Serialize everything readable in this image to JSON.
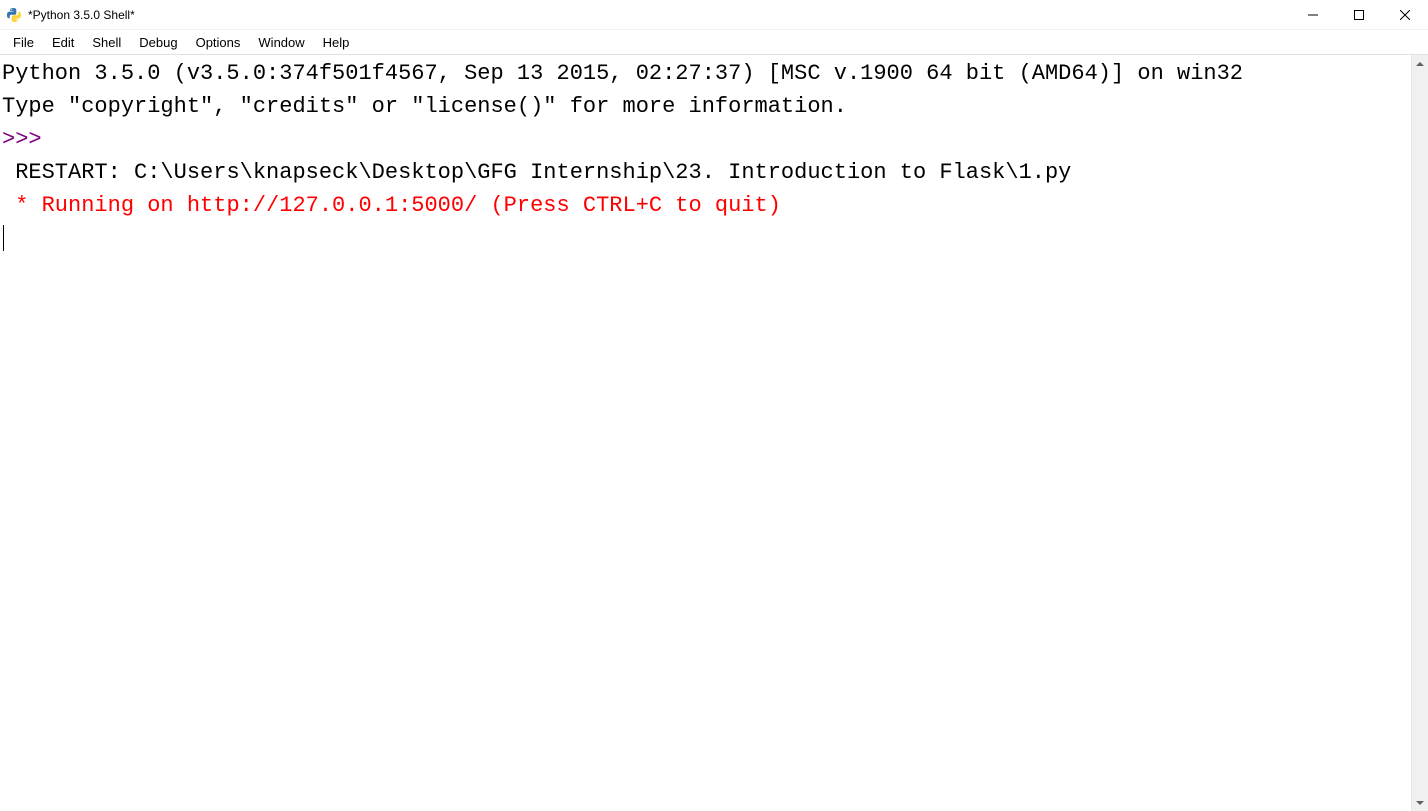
{
  "window": {
    "title": "*Python 3.5.0 Shell*"
  },
  "menu": {
    "file": "File",
    "edit": "Edit",
    "shell": "Shell",
    "debug": "Debug",
    "options": "Options",
    "window": "Window",
    "help": "Help"
  },
  "shell": {
    "banner_line1": "Python 3.5.0 (v3.5.0:374f501f4567, Sep 13 2015, 02:27:37) [MSC v.1900 64 bit (AMD64)] on win32",
    "banner_line2": "Type \"copyright\", \"credits\" or \"license()\" for more information.",
    "prompt": ">>> ",
    "restart_line": " RESTART: C:\\Users\\knapseck\\Desktop\\GFG Internship\\23. Introduction to Flask\\1.py ",
    "running_line": " * Running on http://127.0.0.1:5000/ (Press CTRL+C to quit)"
  }
}
